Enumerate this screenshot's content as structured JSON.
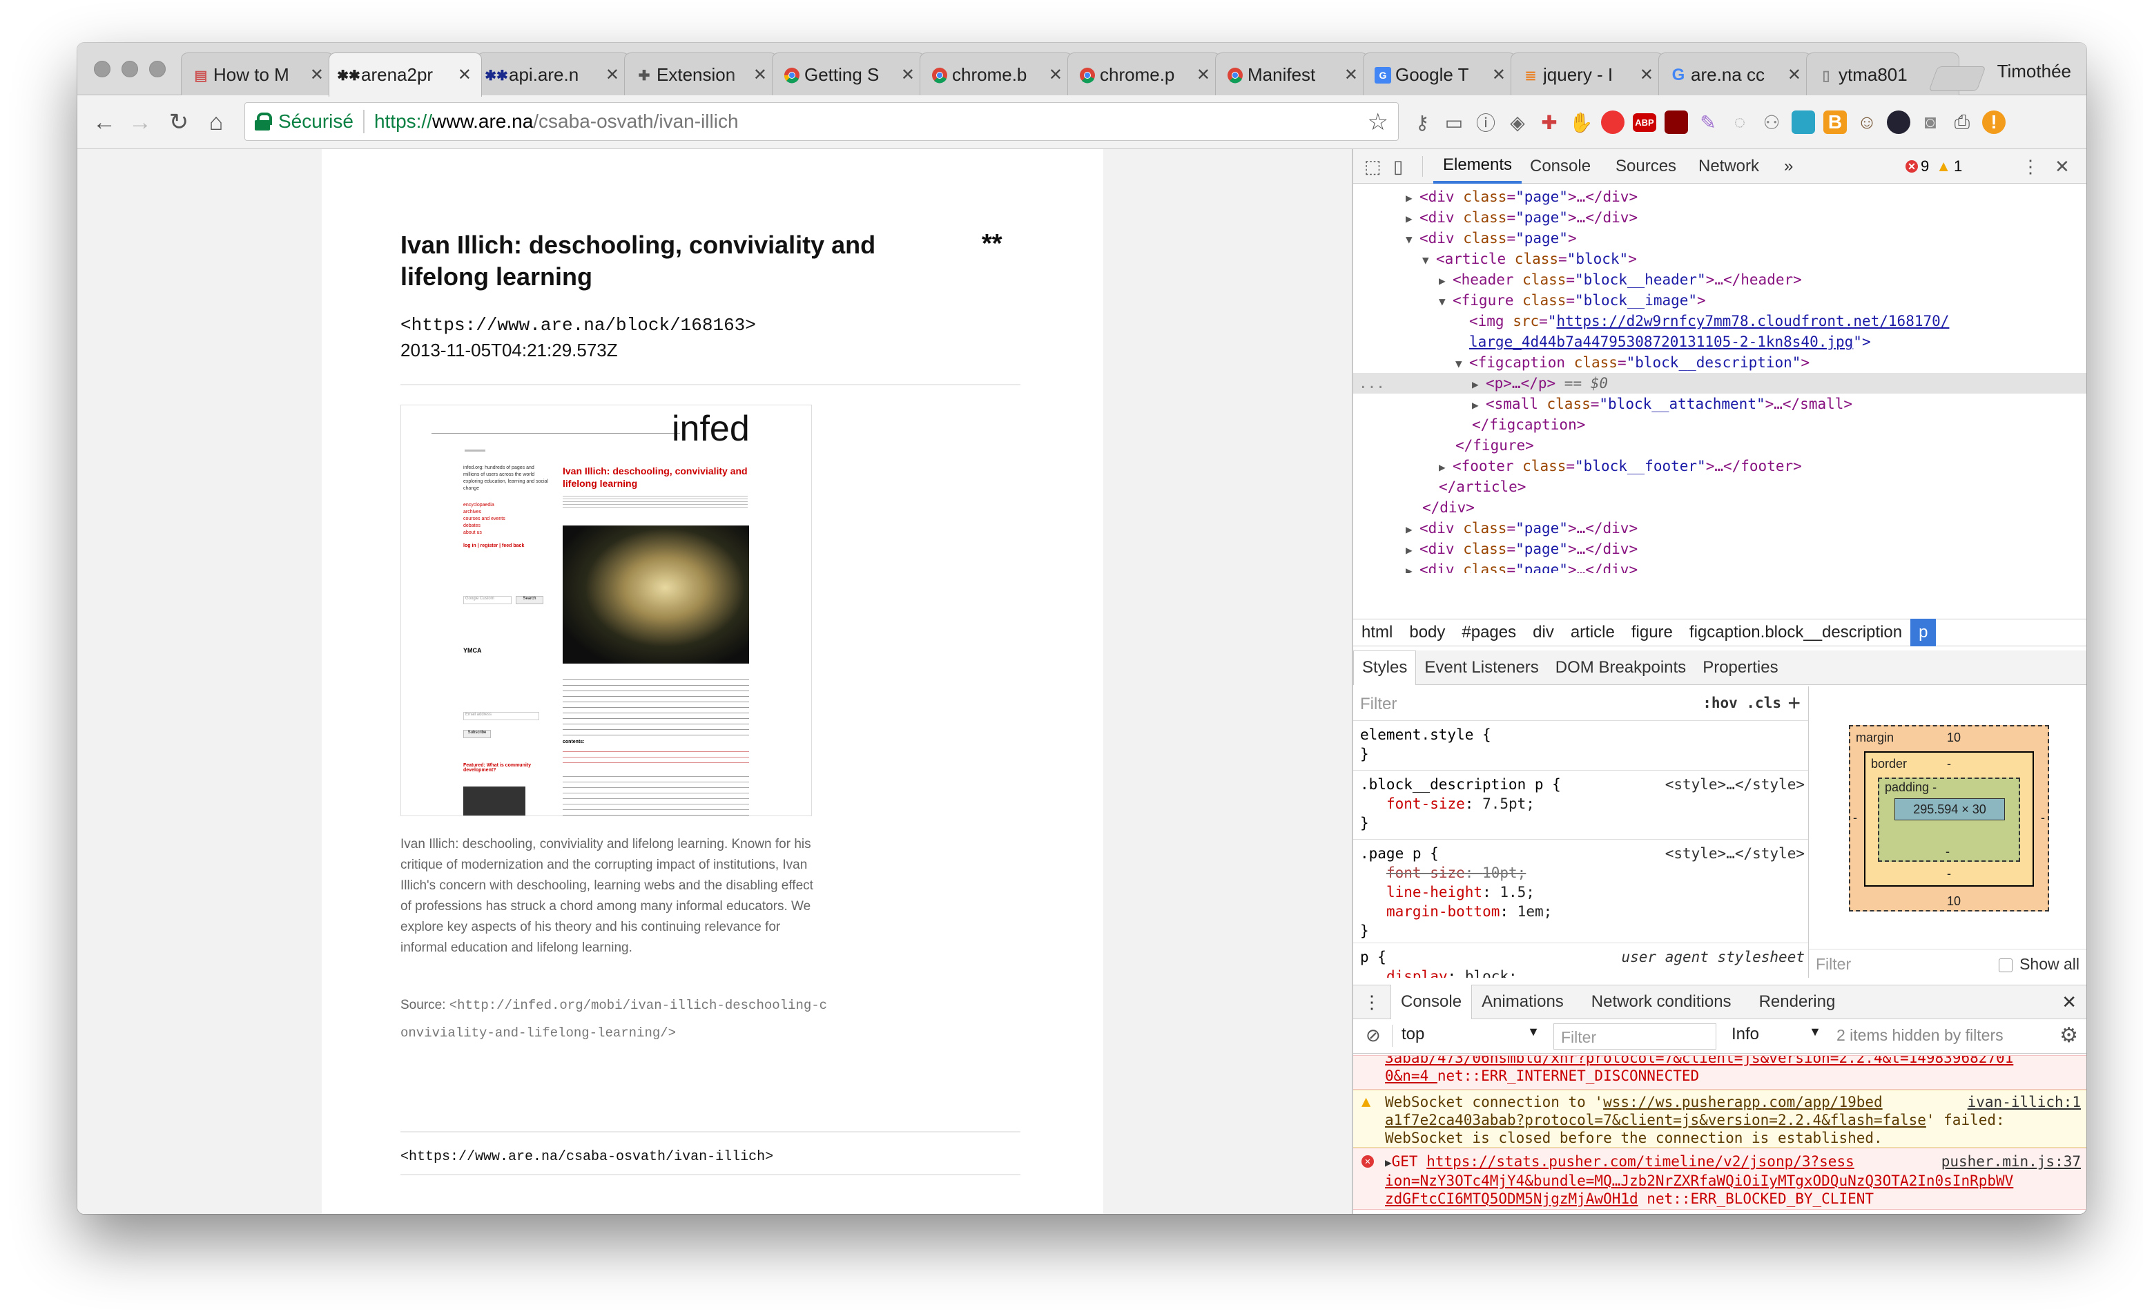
{
  "browser": {
    "user": "Timothée",
    "tabs": [
      {
        "label": "How to M",
        "icon": "inbox-icon",
        "active": false
      },
      {
        "label": "arena2pr",
        "icon": "arena-icon",
        "active": true
      },
      {
        "label": "api.are.n",
        "icon": "arena-icon",
        "active": false
      },
      {
        "label": "Extension",
        "icon": "puzzle-icon",
        "active": false
      },
      {
        "label": "Getting S",
        "icon": "chrome-icon",
        "active": false
      },
      {
        "label": "chrome.b",
        "icon": "chrome-icon",
        "active": false
      },
      {
        "label": "chrome.p",
        "icon": "chrome-icon",
        "active": false
      },
      {
        "label": "Manifest",
        "icon": "chrome-icon",
        "active": false
      },
      {
        "label": "Google T",
        "icon": "translate-icon",
        "active": false
      },
      {
        "label": "jquery - I",
        "icon": "stackoverflow-icon",
        "active": false
      },
      {
        "label": "are.na cc",
        "icon": "google-icon",
        "active": false
      },
      {
        "label": "ytma801",
        "icon": "document-icon",
        "active": false
      }
    ],
    "address": {
      "secure_label": "Sécurisé",
      "scheme": "https://",
      "host": "www.are.na",
      "path": "/csaba-osvath/ivan-illich"
    }
  },
  "page": {
    "title": "Ivan Illich: deschooling, conviviality and lifelong learning",
    "asterisk": "**",
    "block_url": "<https://www.are.na/block/168163>",
    "timestamp": "2013-11-05T04:21:29.573Z",
    "caption": "Ivan Illich: deschooling, conviviality and lifelong learning. Known for his critique of modernization and the corrupting impact of institutions, Ivan Illich's concern with deschooling, learning webs and the disabling effect of professions has struck a chord among many informal educators. We explore key aspects of his theory and his continuing relevance for informal education and lifelong learning.",
    "source_label": "Source:",
    "source_link": "<http://infed.org/mobi/ivan-illich-deschooling-conviviality-and-lifelong-learning/>",
    "footer_url": "<https://www.are.na/csaba-osvath/ivan-illich>",
    "thumb": {
      "logo": "infed",
      "article_title": "Ivan Illich: deschooling, conviviality and lifelong learning",
      "sidebar_text": "infed.org: hundreds of pages and millions of users across the world exploring education, learning and social change",
      "links": [
        "encyclopaedia",
        "archives",
        "courses and events",
        "debates",
        "about us"
      ],
      "login": "log in | register | feed back",
      "search_placeholder": "Google Custom",
      "search_button": "Search",
      "signup_placeholder": "Email address",
      "subscribe_button": "Subscribe",
      "featured": "Featured: What is community development?",
      "contents_label": "contents:",
      "ymca": "YMCA"
    }
  },
  "devtools": {
    "tabs": [
      "Elements",
      "Console",
      "Sources",
      "Network"
    ],
    "more": "»",
    "errors": "9",
    "warnings": "1",
    "dom": {
      "l1": {
        "tag": "<div ",
        "attr": "class",
        "val": "\"page\"",
        "rest": ">…</div>"
      },
      "l2": {
        "tag": "<div ",
        "attr": "class",
        "val": "\"page\"",
        "rest": ">…</div>"
      },
      "l3": {
        "tag": "<div ",
        "attr": "class",
        "val": "\"page\"",
        "rest": ">"
      },
      "l4": {
        "tag": "<article ",
        "attr": "class",
        "val": "\"block\"",
        "rest": ">"
      },
      "l5": {
        "tag": "<header ",
        "attr": "class",
        "val": "\"block__header\"",
        "rest": ">…</header>"
      },
      "l6": {
        "tag": "<figure ",
        "attr": "class",
        "val": "\"block__image\"",
        "rest": ">"
      },
      "l7": {
        "tag": "<img ",
        "attr": "src",
        "val": "\"",
        "link": "https://d2w9rnfcy7mm78.cloudfront.net/168170/",
        "rest": ""
      },
      "l8": {
        "link": "large_4d44b7a44795308720131105-2-1kn8s40.jpg",
        "rest": "\">"
      },
      "l9": {
        "tag": "<figcaption ",
        "attr": "class",
        "val": "\"block__description\"",
        "rest": ">"
      },
      "l10": {
        "tag": "<p>…</p>",
        "rest": " == $0",
        "dots": "..."
      },
      "l11": {
        "tag": "<small ",
        "attr": "class",
        "val": "\"block__attachment\"",
        "rest": ">…</small>"
      },
      "l12": {
        "tag": "</figcaption>"
      },
      "l13": {
        "tag": "</figure>"
      },
      "l14": {
        "tag": "<footer ",
        "attr": "class",
        "val": "\"block__footer\"",
        "rest": ">…</footer>"
      },
      "l15": {
        "tag": "</article>"
      },
      "l16": {
        "tag": "</div>"
      },
      "l17": {
        "tag": "<div ",
        "attr": "class",
        "val": "\"page\"",
        "rest": ">…</div>"
      },
      "l18": {
        "tag": "<div ",
        "attr": "class",
        "val": "\"page\"",
        "rest": ">…</div>"
      },
      "l19": {
        "tag": "<div ",
        "attr": "class",
        "val": "\"page\"",
        "rest": ">…</div>"
      }
    },
    "breadcrumbs": [
      "html",
      "body",
      "#pages",
      "div",
      "article",
      "figure",
      "figcaption.block__description",
      "p"
    ],
    "style_tabs": [
      "Styles",
      "Event Listeners",
      "DOM Breakpoints",
      "Properties"
    ],
    "styles_filter": "Filter",
    "styles_opts": ":hov  .cls",
    "rules": {
      "r1": {
        "selector": "element.style {",
        "close": "}"
      },
      "r2": {
        "selector": ".block__description p {",
        "source": "<style>…</style>",
        "prop": "font-size",
        "value": "7.5pt;",
        "close": "}"
      },
      "r3": {
        "selector": ".page p {",
        "source": "<style>…</style>",
        "p1": "font-size",
        "v1": "10pt;",
        "p2": "line-height",
        "v2": "1.5;",
        "p3": "margin-bottom",
        "v3": "1em;",
        "close": "}"
      },
      "r4": {
        "selector": "p {",
        "source": "user agent stylesheet",
        "prop": "display",
        "value": "block;"
      }
    },
    "box_model": {
      "margin_label": "margin",
      "margin_top": "10",
      "margin_bottom": "10",
      "margin_side": "-",
      "border_label": "border",
      "border_val": "-",
      "padding_label": "padding -",
      "padding_val": "-",
      "content": "295.594 × 30"
    },
    "bm_filter": "Filter",
    "show_all": "Show all",
    "drawer_tabs": [
      "Console",
      "Animations",
      "Network conditions",
      "Rendering"
    ],
    "console": {
      "context": "top",
      "filter": "Filter",
      "level": "Info",
      "hidden": "2 items hidden by filters",
      "m1a": "3abab/473/06nsmbld/xhr?protocol=7&client=js&version=2.2.4&t=149839682701",
      "m1b": "0&n=4 ",
      "m1c": "net::ERR_INTERNET_DISCONNECTED",
      "m2a": "WebSocket connection to '",
      "m2link": "wss://ws.pusherapp.com/app/19bed",
      "m2right": "ivan-illich:1",
      "m2b": "a1f7e2ca403abab?protocol=7&client=js&version=2.2.4&flash=false",
      "m2c": "' failed:",
      "m2d": "WebSocket is closed before the connection is established.",
      "m3get": "GET ",
      "m3link": "https://stats.pusher.com/timeline/v2/jsonp/3?sess",
      "m3right": "pusher.min.js:37",
      "m3b": "ion=NzY3OTc4MjY4&bundle=MQ…Jzb2NrZXRfaWQiOiIyMTgxODQuNzQ3OTA2In0sInRpbWV",
      "m3c": "zdGFtcCI6MTQ5ODM5NjgzMjAwOH1d",
      "m3d": " net::ERR_BLOCKED_BY_CLIENT",
      "prompt": "›"
    }
  }
}
